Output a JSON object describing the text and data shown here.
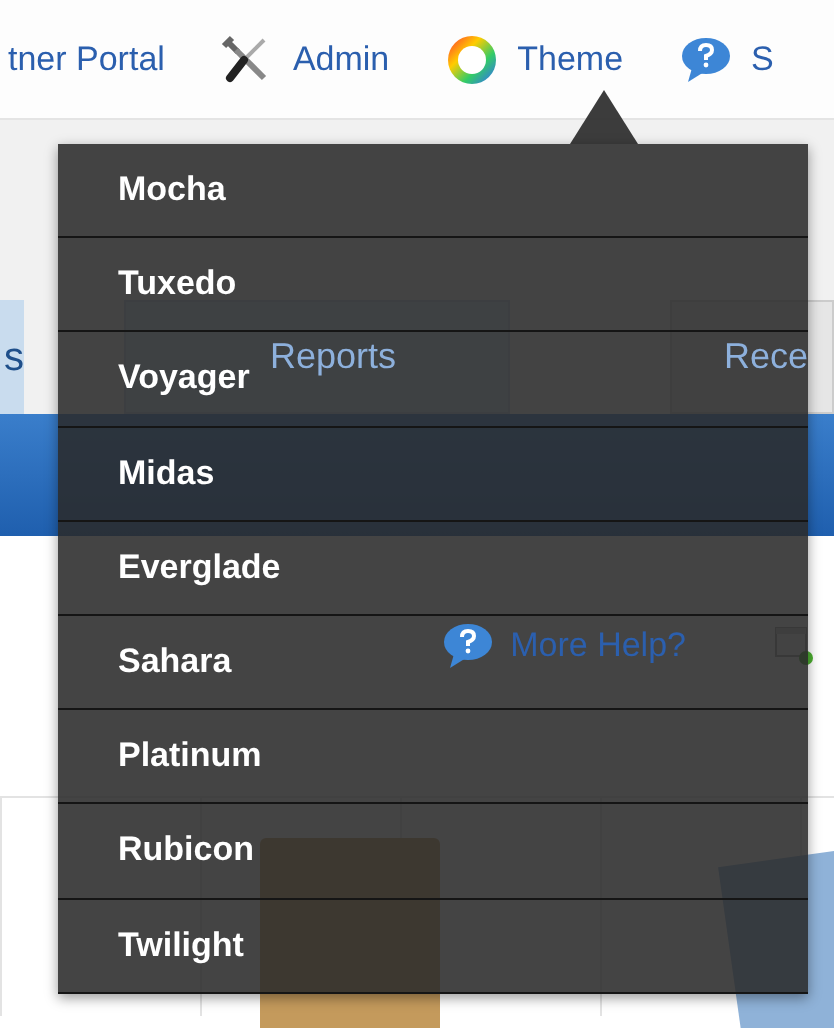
{
  "nav": [
    {
      "label": "tner Portal"
    },
    {
      "label": "Admin"
    },
    {
      "label": "Theme"
    },
    {
      "label": "S"
    }
  ],
  "tabs": [
    {
      "label": "s"
    },
    {
      "label": "Reports"
    },
    {
      "label": "Rece"
    }
  ],
  "help_link": "More Help?",
  "theme_menu": {
    "items": [
      "Mocha",
      "Tuxedo",
      "Voyager",
      "Midas",
      "Everglade",
      "Sahara",
      "Platinum",
      "Rubicon",
      "Twilight"
    ]
  }
}
